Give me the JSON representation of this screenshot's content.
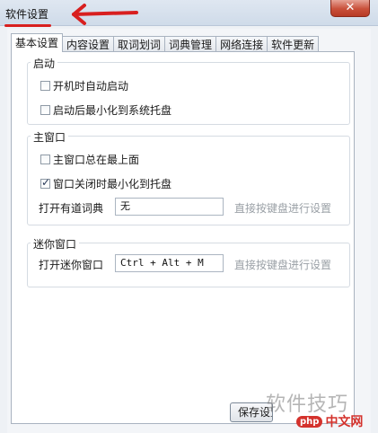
{
  "window": {
    "title": "软件设置",
    "close_glyph": "✕"
  },
  "annotation": {
    "color": "#d81f1f",
    "kind": "red-arrow-pointing-left"
  },
  "tabs": [
    {
      "label": "基本设置",
      "active": true
    },
    {
      "label": "内容设置",
      "active": false
    },
    {
      "label": "取词划词",
      "active": false
    },
    {
      "label": "词典管理",
      "active": false
    },
    {
      "label": "网络连接",
      "active": false
    },
    {
      "label": "软件更新",
      "active": false
    }
  ],
  "startup": {
    "title": "启动",
    "items": [
      {
        "label": "开机时自动启动",
        "checked": false
      },
      {
        "label": "启动后最小化到系统托盘",
        "checked": false
      }
    ]
  },
  "main_window": {
    "title": "主窗口",
    "items": [
      {
        "label": "主窗口总在最上面",
        "checked": false
      },
      {
        "label": "窗口关闭时最小化到托盘",
        "checked": true
      }
    ],
    "hotkey_label": "打开有道词典",
    "hotkey_value": "无",
    "hotkey_hint": "直接按键盘进行设置"
  },
  "mini_window": {
    "title": "迷你窗口",
    "hotkey_label": "打开迷你窗口",
    "hotkey_value": "Ctrl + Alt + M",
    "hotkey_hint": "直接按键盘进行设置"
  },
  "footer": {
    "save_label": "保存设置"
  },
  "watermark": {
    "text": "软件技巧",
    "logo_badge": "php",
    "logo_site": "中文网"
  }
}
